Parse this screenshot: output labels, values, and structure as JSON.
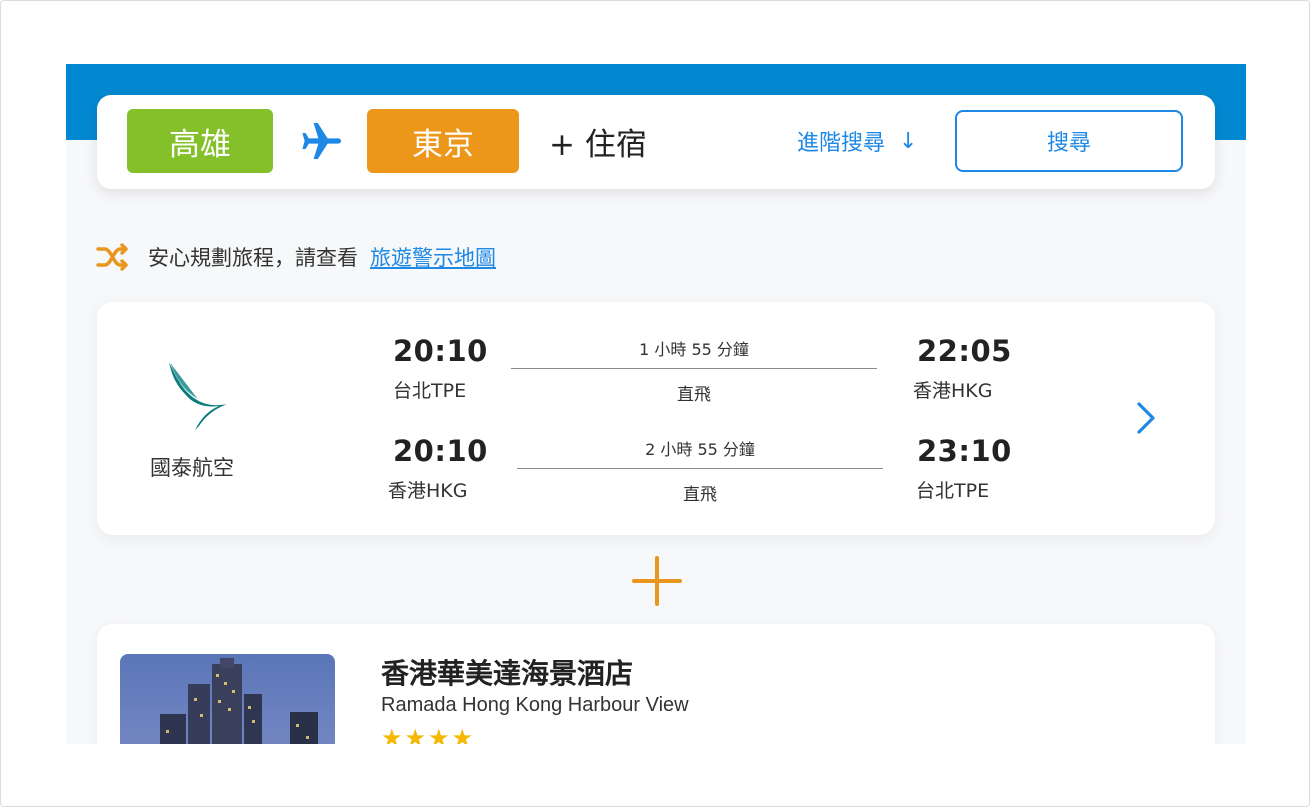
{
  "search": {
    "from_city": "高雄",
    "to_city": "東京",
    "add_stay": "+ 住宿",
    "advanced": "進階搜尋",
    "advanced_arrow": "↓",
    "search_button": "搜尋"
  },
  "notice": {
    "text": "安心規劃旅程，請查看",
    "link": "旅遊警示地圖"
  },
  "flight": {
    "airline": "國泰航空",
    "legs": [
      {
        "dep_time": "20:10",
        "dep_airport": "台北TPE",
        "duration": "1 小時 55 分鐘",
        "stops": "直飛",
        "arr_time": "22:05",
        "arr_airport": "香港HKG"
      },
      {
        "dep_time": "20:10",
        "dep_airport": "香港HKG",
        "duration": "2 小時 55 分鐘",
        "stops": "直飛",
        "arr_time": "23:10",
        "arr_airport": "台北TPE"
      }
    ]
  },
  "hotel": {
    "name": "香港華美達海景酒店",
    "name_en": "Ramada Hong Kong Harbour View",
    "stars": "★★★★",
    "rating_stars": 4
  },
  "colors": {
    "brand_blue": "#0288d1",
    "accent_blue": "#1e88e5",
    "from_green": "#84c02a",
    "to_orange": "#ec961a",
    "plus_orange": "#e8961e",
    "star_yellow": "#f5b800"
  },
  "icons": {
    "plane": "airplane-icon",
    "shuffle": "shuffle-icon",
    "chevron": "chevron-right-icon",
    "plus": "plus-icon"
  }
}
